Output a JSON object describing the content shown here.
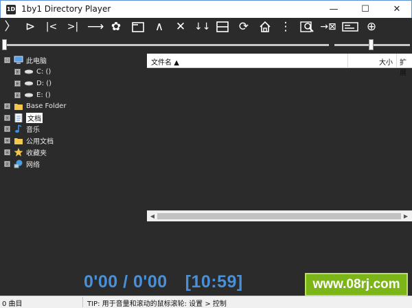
{
  "window": {
    "app_icon_text": "1D",
    "title": "1by1 Directory Player",
    "minimize_glyph": "—",
    "maximize_glyph": "☐",
    "close_glyph": "✕"
  },
  "toolbar": {
    "icons": [
      "play-icon",
      "play-directory-icon",
      "previous-icon",
      "next-icon",
      "skip-icon",
      "settings-icon",
      "playlist-view-icon",
      "collapse-icon",
      "stop-icon",
      "sort-icon",
      "split-view-icon",
      "repeat-icon",
      "home-icon",
      "more-menu-icon",
      "search-file-icon",
      "remove-file-icon",
      "tag-editor-icon",
      "add-icon"
    ],
    "glyphs": {
      "play": "〉",
      "play_dir": "⊳",
      "prev": "|<",
      "next": ">|",
      "skip": "⟶",
      "settings": "✿",
      "collapse": "∧",
      "stop": "✕",
      "sort": "↓↓",
      "repeat": "⟳",
      "more": "⋮",
      "remove": "→⊠",
      "add": "⊕"
    }
  },
  "seek": {
    "position": 0.0
  },
  "volume": {
    "level": 0.48
  },
  "tree": {
    "items": [
      {
        "label": "此电脑",
        "expander": "⊟",
        "icon": "computer-icon"
      },
      {
        "label": "C: ()",
        "expander": "⊞",
        "icon": "drive-icon"
      },
      {
        "label": "D: ()",
        "expander": "⊞",
        "icon": "drive-icon"
      },
      {
        "label": "E: ()",
        "expander": "⊞",
        "icon": "drive-icon"
      },
      {
        "label": "Base Folder",
        "expander": "⊞",
        "icon": "folder-icon"
      },
      {
        "label": "文档",
        "expander": "⊞",
        "icon": "document-icon",
        "selected": true
      },
      {
        "label": "音乐",
        "expander": "⊞",
        "icon": "music-note-icon"
      },
      {
        "label": "公用文档",
        "expander": "⊞",
        "icon": "folder-icon"
      },
      {
        "label": "收藏夹",
        "expander": "⊞",
        "icon": "star-icon"
      },
      {
        "label": "网络",
        "expander": "⊞",
        "icon": "network-icon"
      }
    ]
  },
  "file_list": {
    "columns": {
      "name": "文件名",
      "sort_indicator": "▲",
      "size": "大小",
      "ext": "扩展"
    },
    "scroll_left": "◀",
    "scroll_right": "▶"
  },
  "player": {
    "time": "0'00 / 0'00",
    "remaining": "[10:59]"
  },
  "watermark": {
    "text": "www.08rj.com"
  },
  "status": {
    "track_count": "0 曲目",
    "tip": "TIP: 用于音量和滚动的鼠标滚轮: 设置 > 控制"
  },
  "colors": {
    "background": "#2b2b2b",
    "time_text": "#4a90d9",
    "watermark_bg": "#7cb518",
    "window_border": "#5a8fd8"
  }
}
